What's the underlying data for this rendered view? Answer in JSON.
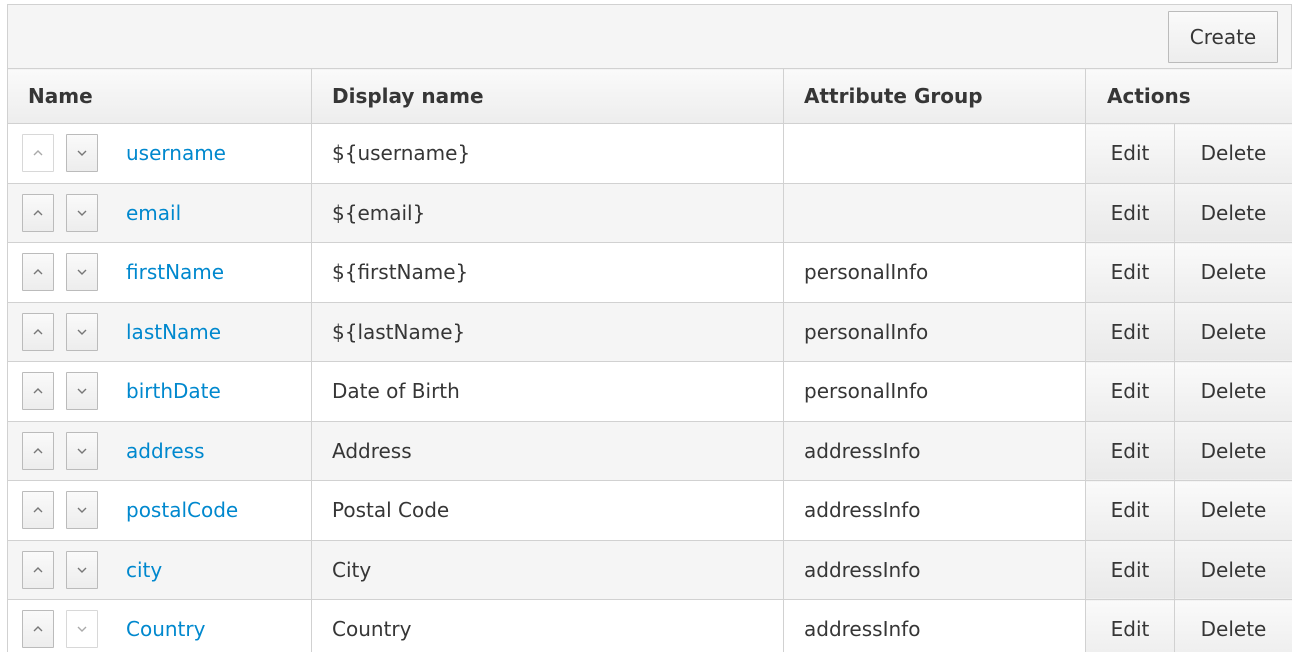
{
  "toolbar": {
    "create_label": "Create"
  },
  "table": {
    "headers": {
      "name": "Name",
      "display_name": "Display name",
      "attribute_group": "Attribute Group",
      "actions": "Actions"
    },
    "rows": [
      {
        "name": "username",
        "display_name": "${username}",
        "group": "",
        "edit": "Edit",
        "delete": "Delete"
      },
      {
        "name": "email",
        "display_name": "${email}",
        "group": "",
        "edit": "Edit",
        "delete": "Delete"
      },
      {
        "name": "firstName",
        "display_name": "${firstName}",
        "group": "personalInfo",
        "edit": "Edit",
        "delete": "Delete"
      },
      {
        "name": "lastName",
        "display_name": "${lastName}",
        "group": "personalInfo",
        "edit": "Edit",
        "delete": "Delete"
      },
      {
        "name": "birthDate",
        "display_name": "Date of Birth",
        "group": "personalInfo",
        "edit": "Edit",
        "delete": "Delete"
      },
      {
        "name": "address",
        "display_name": "Address",
        "group": "addressInfo",
        "edit": "Edit",
        "delete": "Delete"
      },
      {
        "name": "postalCode",
        "display_name": "Postal Code",
        "group": "addressInfo",
        "edit": "Edit",
        "delete": "Delete"
      },
      {
        "name": "city",
        "display_name": "City",
        "group": "addressInfo",
        "edit": "Edit",
        "delete": "Delete"
      },
      {
        "name": "Country",
        "display_name": "Country",
        "group": "addressInfo",
        "edit": "Edit",
        "delete": "Delete"
      }
    ]
  },
  "icons": {
    "up": "chevron-up-icon",
    "down": "chevron-down-icon"
  },
  "colors": {
    "link": "#0088ce",
    "border": "#d1d1d1",
    "stripe": "#f5f5f5"
  }
}
